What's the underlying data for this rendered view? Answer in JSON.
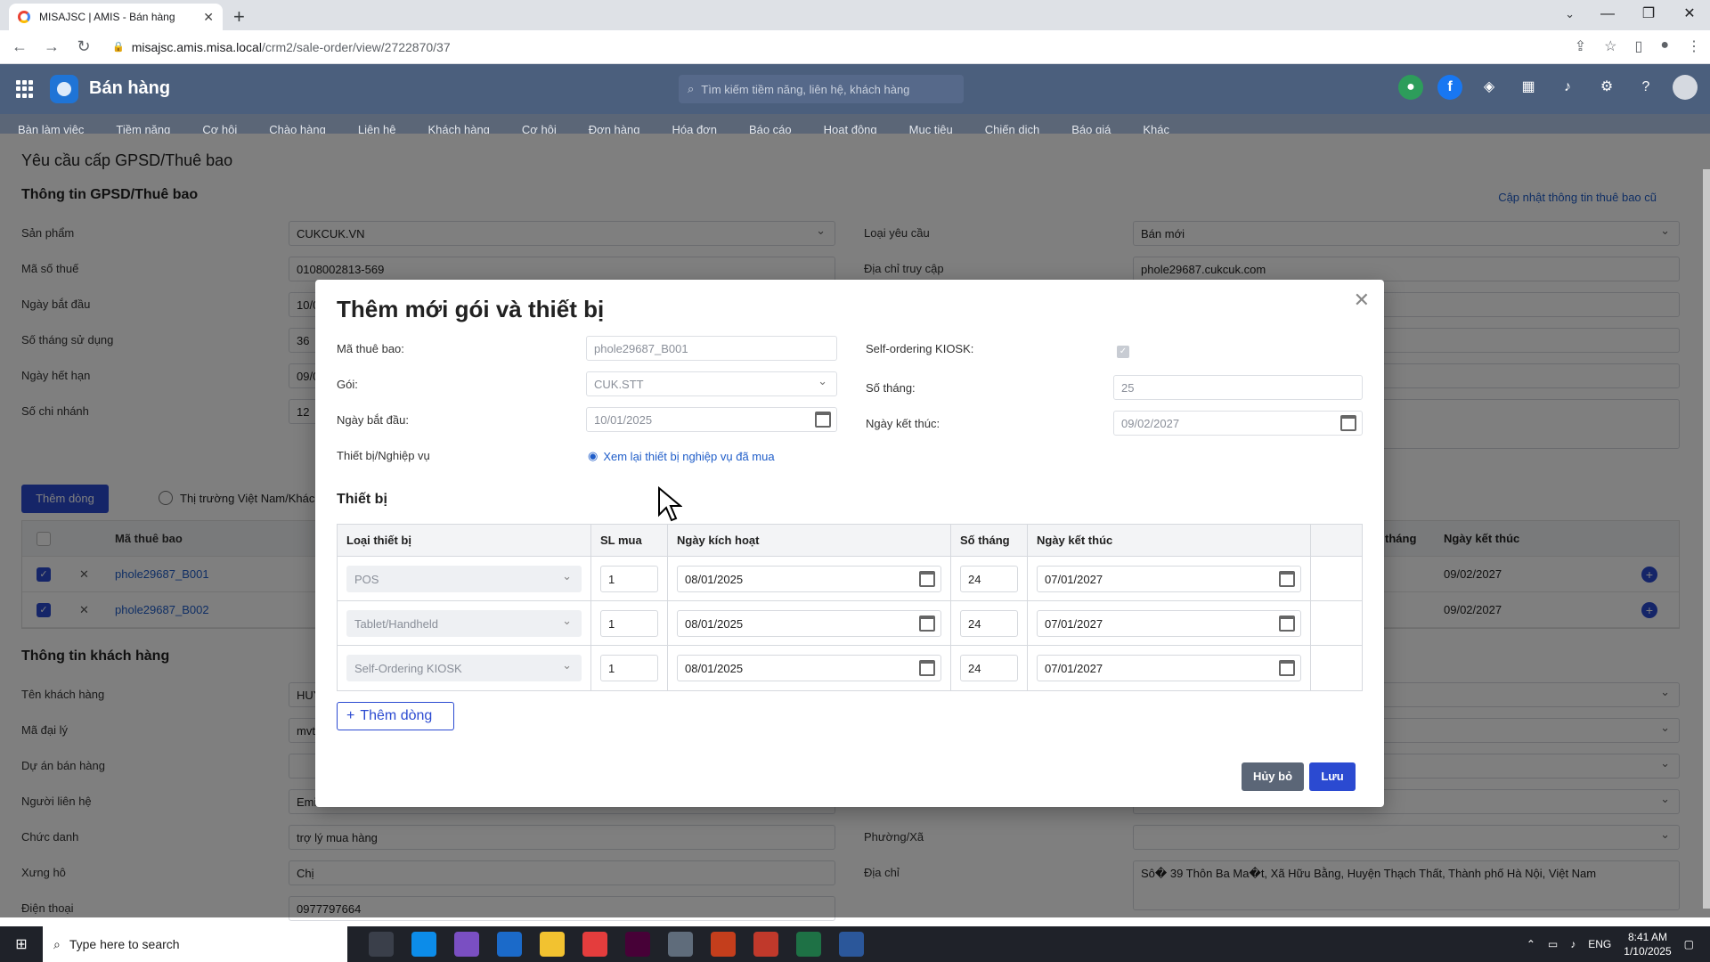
{
  "browser": {
    "tab_title": "MISAJSC | AMIS - Bán hàng",
    "url_host": "misajsc.amis.misa.local",
    "url_path": "/crm2/sale-order/view/2722870/37"
  },
  "app": {
    "title": "Bán hàng",
    "search_placeholder": "Tìm kiếm tiềm năng, liên hệ, khách hàng",
    "modules": [
      "Bàn làm việc",
      "Tiềm năng",
      "Cơ hội",
      "Chào hàng",
      "Liên hệ",
      "Khách hàng",
      "Cơ hội",
      "Đơn hàng",
      "Hóa đơn",
      "Báo cáo",
      "Hoạt động",
      "Mục tiêu",
      "Chiến dịch",
      "Báo giá",
      "Khác"
    ]
  },
  "page": {
    "title": "Yêu cầu cấp GPSD/Thuê bao",
    "section1": "Thông tin GPSD/Thuê bao",
    "update_link": "Cập nhật thông tin thuê bao cũ",
    "left_fields": [
      {
        "label": "Sản phẩm",
        "value": "CUKCUK.VN"
      },
      {
        "label": "Mã số thuế",
        "value": "0108002813-569"
      },
      {
        "label": "Ngày bắt đầu",
        "value": "10/0"
      },
      {
        "label": "Số tháng sử dụng",
        "value": "36"
      },
      {
        "label": "Ngày hết hạn",
        "value": "09/0"
      },
      {
        "label": "Số chi nhánh",
        "value": "12"
      }
    ],
    "right_fields": [
      {
        "label": "Loại yêu cầu",
        "value": "Bán mới"
      },
      {
        "label": "Địa chỉ truy cập",
        "value": "phole29687.cukcuk.com"
      }
    ],
    "add_button": "Thêm dòng",
    "radio_label": "Thị trường Việt Nam/Khác",
    "table": {
      "col_code": "Mã thuê bao",
      "col_months": "tháng",
      "col_end": "Ngày kết thúc",
      "rows": [
        {
          "code": "phole29687_B001",
          "end": "09/02/2027"
        },
        {
          "code": "phole29687_B002",
          "end": "09/02/2027"
        }
      ]
    },
    "section2": "Thông tin khách hàng",
    "customer_fields": [
      {
        "label": "Tên khách hàng",
        "value": "HUY"
      },
      {
        "label": "Mã đại lý",
        "value": "mvt"
      },
      {
        "label": "Dự án bán hàng",
        "value": ""
      },
      {
        "label": "Người liên hệ",
        "value": "Emi"
      },
      {
        "label": "Chức danh",
        "value": "trợ lý mua hàng"
      },
      {
        "label": "Xưng hô",
        "value": "Chị"
      },
      {
        "label": "Điện thoại",
        "value": "0977797664"
      }
    ],
    "customer_right": [
      {
        "label": "Phường/Xã",
        "value": ""
      },
      {
        "label": "Địa chỉ",
        "value": "Sô� 39 Thôn Ba Ma�t, Xã Hữu Bằng, Huyện Thạch Thất, Thành phố Hà Nội, Việt Nam"
      }
    ]
  },
  "modal": {
    "title": "Thêm mới gói và thiết bị",
    "fields": {
      "subscriber_label": "Mã thuê bao:",
      "subscriber_value": "phole29687_B001",
      "package_label": "Gói:",
      "package_value": "CUK.STT",
      "start_label": "Ngày bắt đầu:",
      "start_value": "10/01/2025",
      "device_label": "Thiết bị/Nghiệp vụ",
      "device_link": "Xem lại thiết bị nghiệp vụ đã mua",
      "kiosk_label": "Self-ordering KIOSK:",
      "months_label": "Số tháng:",
      "months_value": "25",
      "end_label": "Ngày kết thúc:",
      "end_value": "09/02/2027"
    },
    "devices_title": "Thiết bị",
    "columns": [
      "Loại thiết bị",
      "SL mua",
      "Ngày kích hoạt",
      "Số tháng",
      "Ngày kết thúc"
    ],
    "rows": [
      {
        "type": "POS",
        "qty": "1",
        "activate": "08/01/2025",
        "months": "24",
        "end": "07/01/2027"
      },
      {
        "type": "Tablet/Handheld",
        "qty": "1",
        "activate": "08/01/2025",
        "months": "24",
        "end": "07/01/2027"
      },
      {
        "type": "Self-Ordering KIOSK",
        "qty": "1",
        "activate": "08/01/2025",
        "months": "24",
        "end": "07/01/2027"
      }
    ],
    "add_row": "Thêm dòng",
    "cancel": "Hủy bỏ",
    "save": "Lưu"
  },
  "taskbar": {
    "search_placeholder": "Type here to search",
    "lang": "ENG",
    "time": "8:41 AM",
    "date": "1/10/2025"
  }
}
